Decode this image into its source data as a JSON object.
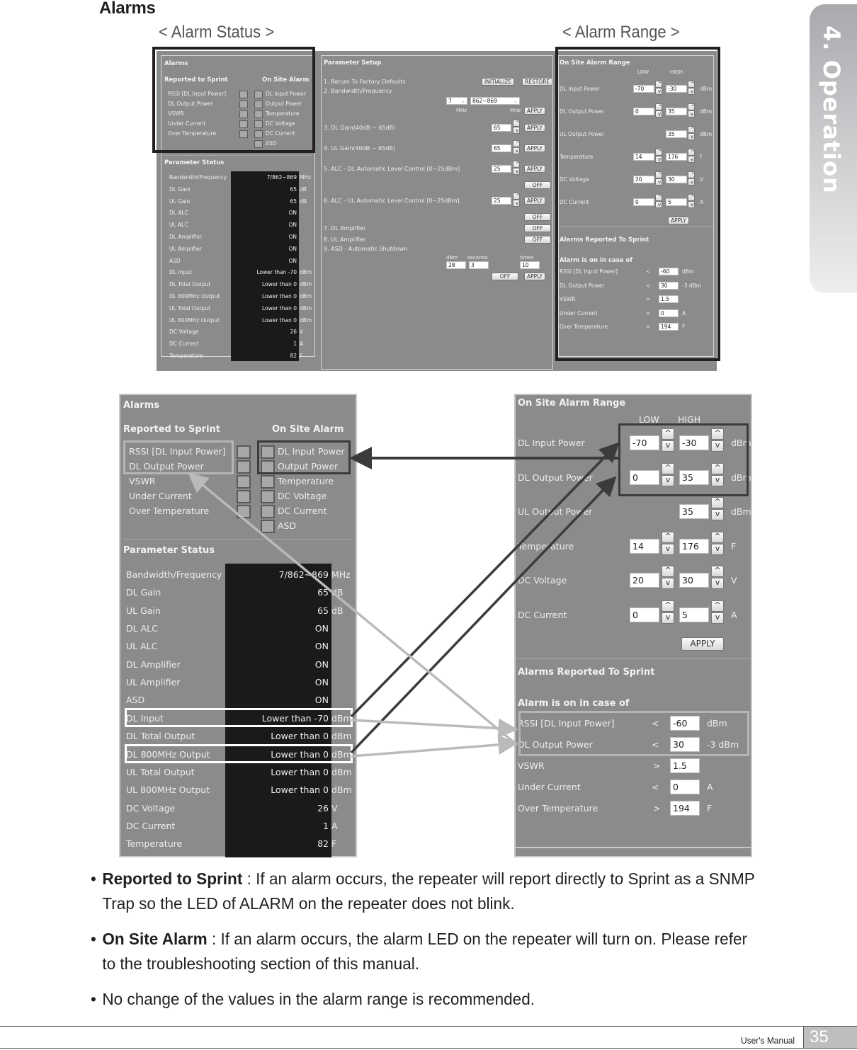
{
  "page": {
    "section_title": "Alarms",
    "caption_status": "< Alarm Status >",
    "caption_range": "< Alarm Range >",
    "side_tab": "4. Operation",
    "footer_manual": "User's Manual",
    "page_number": "35"
  },
  "alarms": {
    "title": "Alarms",
    "reported_header": "Reported to Sprint",
    "onsite_header": "On Site Alarm",
    "reported": [
      "RSSI [DL Input Power]",
      "DL Output Power",
      "VSWR",
      "Under Current",
      "Over Temperature"
    ],
    "onsite": [
      "DL Input Power",
      "Output Power",
      "Temperature",
      "DC Voltage",
      "DC Current",
      "ASD"
    ]
  },
  "status": {
    "title": "Parameter Status",
    "rows": [
      {
        "label": "Bandwidth/Frequency",
        "value": "7/862~869",
        "unit": "MHz"
      },
      {
        "label": "DL Gain",
        "value": "65",
        "unit": "dB"
      },
      {
        "label": "UL Gain",
        "value": "65",
        "unit": "dB"
      },
      {
        "label": "DL ALC",
        "value": "ON",
        "unit": ""
      },
      {
        "label": "UL ALC",
        "value": "ON",
        "unit": ""
      },
      {
        "label": "DL Amplifier",
        "value": "ON",
        "unit": ""
      },
      {
        "label": "UL Amplifier",
        "value": "ON",
        "unit": ""
      },
      {
        "label": "ASD",
        "value": "ON",
        "unit": ""
      },
      {
        "label": "DL Input",
        "value": "Lower than -70",
        "unit": "dBm"
      },
      {
        "label": "DL Total Output",
        "value": "Lower than 0",
        "unit": "dBm"
      },
      {
        "label": "DL 800MHz Output",
        "value": "Lower than 0",
        "unit": "dBm"
      },
      {
        "label": "UL Total Output",
        "value": "Lower than 0",
        "unit": "dBm"
      },
      {
        "label": "UL 800MHz Output",
        "value": "Lower than 0",
        "unit": "dBm"
      },
      {
        "label": "DC Voltage",
        "value": "26",
        "unit": "V"
      },
      {
        "label": "DC Current",
        "value": "1",
        "unit": "A"
      },
      {
        "label": "Temperature",
        "value": "82",
        "unit": "F"
      }
    ]
  },
  "setup": {
    "title": "Parameter Setup",
    "item1": "1. Rerurn To Factory Defaults",
    "initialize": "INITIALIZE",
    "restore": "RESTORE",
    "item2": "2. Bandwidth/Frequency",
    "bw_select": "7",
    "freq_select": "862~869",
    "mhz": "MHz",
    "apply": "APPLY",
    "item3": "3. DL Gain(40dB ~ 65dB)",
    "dl_gain": "65",
    "item4": "4. UL Gain(40dB ~ 65dB)",
    "ul_gain": "65",
    "item5": "5. ALC - DL Automatic Level Control [0~25dBm]",
    "dl_alc": "25",
    "off": "OFF",
    "item6": "6. ALC - UL Automatic Level Control [0~25dBm]",
    "ul_alc": "25",
    "item7": "7. DL Amplifier",
    "item8": "8. UL Amplifier",
    "item9": "9. ASD - Automatic Shutdown",
    "asd_dbm_label": "dBm",
    "asd_seconds_label": "seconds",
    "asd_times_label": "times",
    "asd_dbm": "28",
    "asd_seconds": "3",
    "asd_times": "10"
  },
  "range": {
    "title": "On Site Alarm Range",
    "low": "LOW",
    "high": "HIGH",
    "up": "^",
    "down": "v",
    "apply": "APPLY",
    "rows": [
      {
        "label": "DL Input Power",
        "low": "-70",
        "high": "-30",
        "unit": "dBm"
      },
      {
        "label": "DL Output Power",
        "low": "0",
        "high": "35",
        "unit": "dBm"
      },
      {
        "label": "UL Output Power",
        "low": "",
        "high": "35",
        "unit": "dBm"
      },
      {
        "label": "Temperature",
        "low": "14",
        "high": "176",
        "unit": "F"
      },
      {
        "label": "DC Voltage",
        "low": "20",
        "high": "30",
        "unit": "V"
      },
      {
        "label": "DC Current",
        "low": "0",
        "high": "5",
        "unit": "A"
      }
    ]
  },
  "sprint": {
    "title": "Alarms Reported To Sprint",
    "subtitle": "Alarm is on in case of",
    "rows": [
      {
        "label": "RSSI [DL Input Power]",
        "op": "<",
        "value": "-60",
        "unit": "dBm"
      },
      {
        "label": "DL Output Power",
        "op": "<",
        "value": "30",
        "unit": "-3 dBm"
      },
      {
        "label": "VSWR",
        "op": ">",
        "value": "1.5",
        "unit": ""
      },
      {
        "label": "Under Current",
        "op": "<",
        "value": "0",
        "unit": "A"
      },
      {
        "label": "Over Temperature",
        "op": ">",
        "value": "194",
        "unit": "F"
      }
    ]
  },
  "bullets": [
    {
      "term": "Reported to Sprint",
      "text": " : If an alarm occurs, the repeater will report directly to Sprint as a SNMP Trap so the LED of ALARM on the repeater does not blink."
    },
    {
      "term": "On Site Alarm",
      "text": " : If an alarm occurs, the alarm LED on the repeater will turn on. Please refer to the troubleshooting section of this manual."
    },
    {
      "term": "",
      "text": "No change of the values in the alarm range is recommended."
    }
  ],
  "colors": {
    "panel_bg": "#8a8b8d",
    "status_bg": "#1a1a1a",
    "highlight_dark": "#231f20",
    "highlight_light": "#b4b5b7",
    "highlight_white": "#ffffff",
    "arrow_dark": "#3b3b3d",
    "arrow_light": "#b9babc"
  }
}
